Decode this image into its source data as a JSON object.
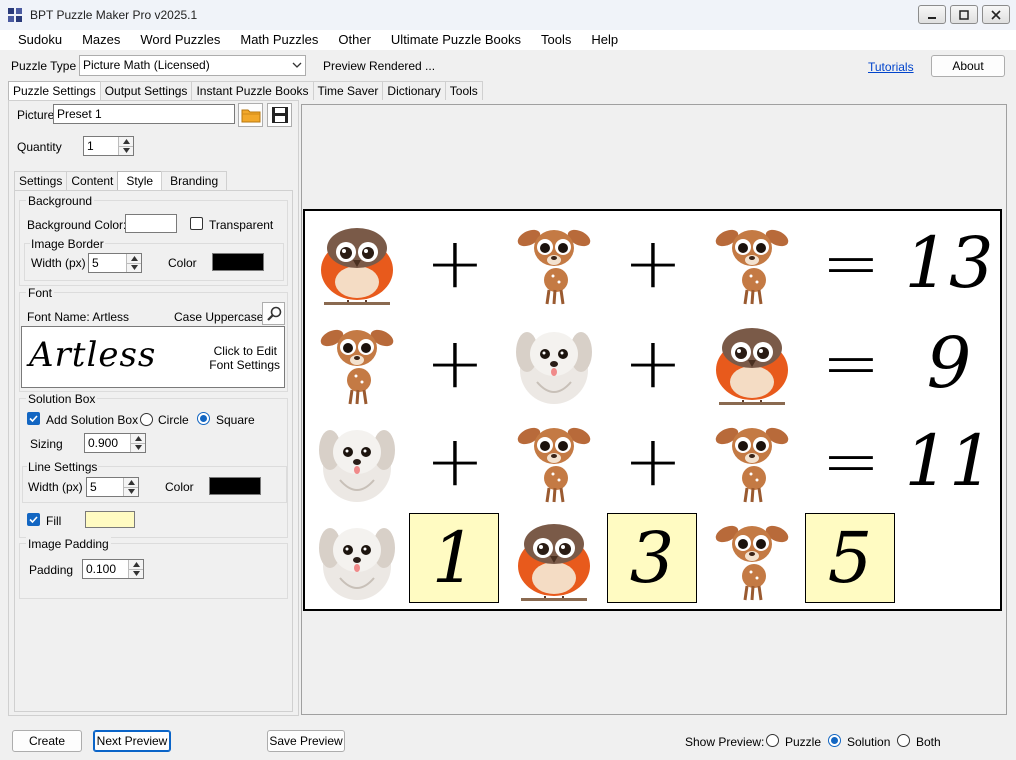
{
  "window": {
    "title": "BPT Puzzle Maker Pro v2025.1"
  },
  "menu": [
    "Sudoku",
    "Mazes",
    "Word Puzzles",
    "Math Puzzles",
    "Other",
    "Ultimate Puzzle Books",
    "Tools",
    "Help"
  ],
  "toolbar": {
    "puzzle_type_label": "Puzzle Type",
    "puzzle_type_value": "Picture Math (Licensed)",
    "status": "Preview Rendered ...",
    "tutorials": "Tutorials",
    "about": "About"
  },
  "main_tabs": [
    "Puzzle Settings",
    "Output Settings",
    "Instant Puzzle Books",
    "Time Saver",
    "Dictionary",
    "Tools"
  ],
  "settings": {
    "picture_label": "Picture",
    "picture_value": "Preset 1",
    "quantity_label": "Quantity",
    "quantity_value": "1"
  },
  "sub_tabs": [
    "Settings",
    "Content",
    "Style",
    "Branding"
  ],
  "style": {
    "background_group": "Background",
    "background_color_label": "Background Color:",
    "transparent_label": "Transparent",
    "image_border_group": "Image Border",
    "border_width_label": "Width (px)",
    "border_width_value": "5",
    "border_color_label": "Color",
    "font_group": "Font",
    "font_name": "Font Name: Artless",
    "case": "Case Uppercase",
    "font_sample": "Artless",
    "font_hint_1": "Click to Edit",
    "font_hint_2": "Font Settings",
    "solution_group": "Solution Box",
    "add_solution_label": "Add Solution Box",
    "circle_label": "Circle",
    "square_label": "Square",
    "sizing_label": "Sizing",
    "sizing_value": "0.900",
    "line_group": "Line Settings",
    "line_width_label": "Width (px)",
    "line_width_value": "5",
    "line_color_label": "Color",
    "fill_label": "Fill",
    "padding_group": "Image Padding",
    "padding_label": "Padding",
    "padding_value": "0.100"
  },
  "colors": {
    "background_color": "#ffffff",
    "border_color": "#000000",
    "line_color": "#000000",
    "fill_color": "#fffbc2",
    "accent": "#1366c2"
  },
  "puzzle": {
    "rows": [
      {
        "cells": [
          "bird",
          "+",
          "deer",
          "+",
          "deer",
          "=",
          "13"
        ]
      },
      {
        "cells": [
          "deer",
          "+",
          "dog",
          "+",
          "bird",
          "=",
          "9"
        ]
      },
      {
        "cells": [
          "dog",
          "+",
          "deer",
          "+",
          "deer",
          "=",
          "11"
        ]
      }
    ],
    "solution_row": [
      {
        "pic": "dog",
        "answer": "1"
      },
      {
        "pic": "bird",
        "answer": "3"
      },
      {
        "pic": "deer",
        "answer": "5"
      }
    ]
  },
  "bottom": {
    "create": "Create",
    "next_preview": "Next Preview",
    "save_preview": "Save Preview",
    "show_preview_label": "Show Preview:",
    "opt_puzzle": "Puzzle",
    "opt_solution": "Solution",
    "opt_both": "Both"
  }
}
